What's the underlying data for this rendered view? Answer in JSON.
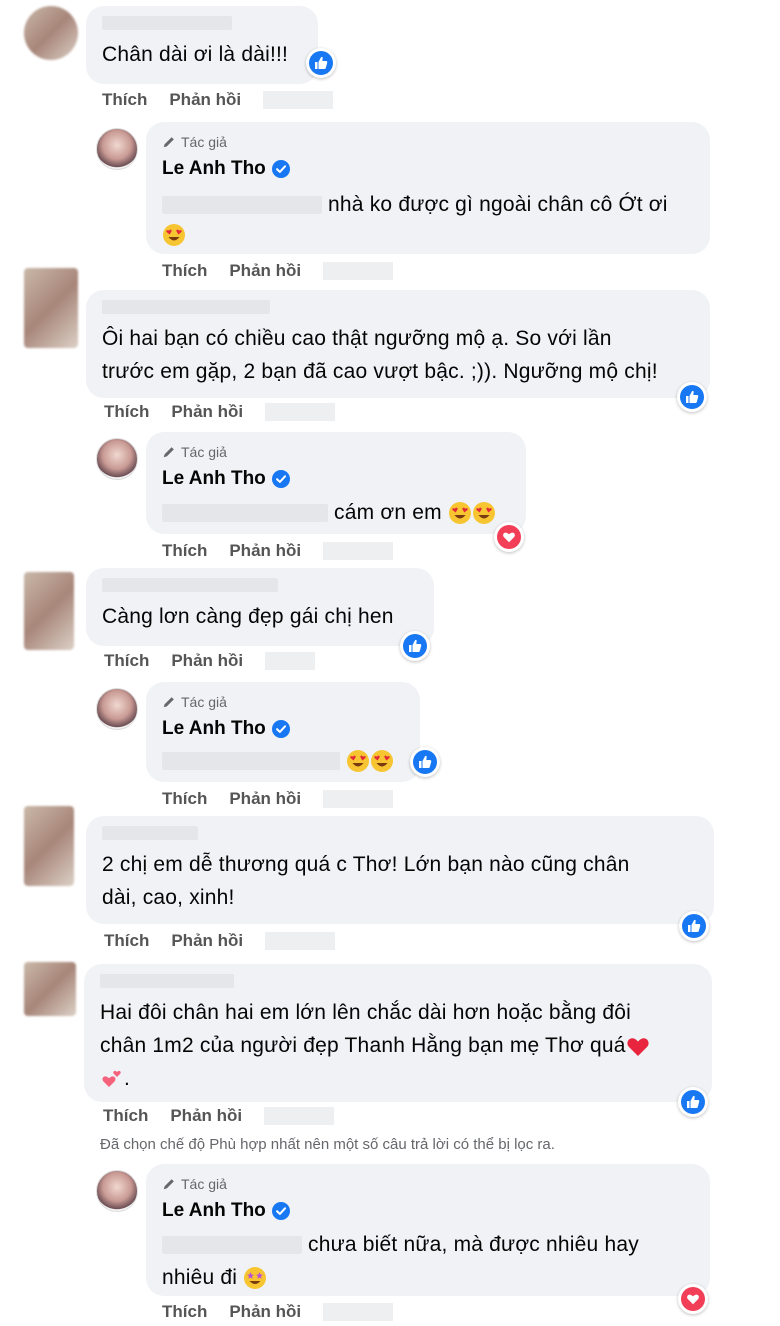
{
  "labels": {
    "like": "Thích",
    "reply": "Phản hồi",
    "author_tag": "Tác giả"
  },
  "author": {
    "name": "Le Anh Tho"
  },
  "filter_note": "Đã chọn chế độ Phù hợp nhất nên một số câu trả lời có thể bị lọc ra.",
  "comments": [
    {
      "text": "Chân dài ơi là dài!!!",
      "reaction": "like"
    },
    {
      "text": "nhà ko được gì ngoài chân cô Ớt ơi",
      "reaction": ""
    },
    {
      "text_line1": "Ôi hai bạn có chiều cao thật ngưỡng mộ ạ. So với lần",
      "text_line2": "trước em gặp, 2 bạn đã cao vượt bậc. ;)). Ngưỡng mộ chị!",
      "reaction": "like"
    },
    {
      "text": "cám ơn em",
      "reaction": "love"
    },
    {
      "text": "Càng lơn càng đẹp gái chị hen",
      "reaction": "like"
    },
    {
      "text": "",
      "reaction": "like"
    },
    {
      "text_line1": "2 chị em dễ thương quá c Thơ! Lớn bạn nào cũng chân",
      "text_line2": "dài, cao, xinh!",
      "reaction": "like"
    },
    {
      "text_line1": "Hai đôi chân hai em lớn lên chắc dài hơn hoặc bằng đôi",
      "text_line2": "chân 1m2 của người đẹp Thanh Hằng bạn mẹ Thơ quá",
      "text_line3": ".",
      "reaction": "like"
    },
    {
      "text_line1": "chưa biết nữa, mà được nhiêu hay",
      "text_line2": "nhiêu đi",
      "reaction": "love"
    }
  ],
  "icons": {
    "like": "like-icon",
    "love": "love-icon",
    "verified": "verified-badge-icon",
    "pen": "pen-icon"
  },
  "colors": {
    "like_blue": "#1877f2",
    "love_red": "#f33e58",
    "bubble_bg": "#f0f2f5",
    "meta_gray": "#65676b"
  }
}
